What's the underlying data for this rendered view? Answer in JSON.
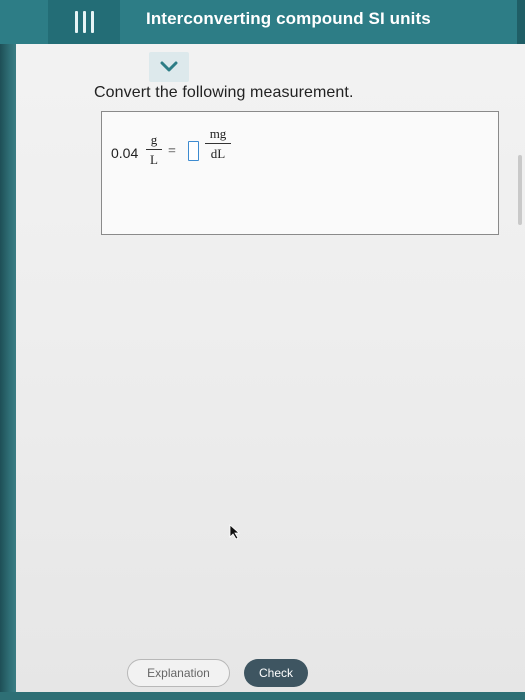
{
  "header": {
    "title": "Interconverting compound SI units",
    "menu_icon": "hamburger-icon",
    "accent_color": "#2d7d86"
  },
  "collapse": {
    "icon": "chevron-down-icon",
    "color": "#2d7d86"
  },
  "question": {
    "prompt": "Convert the following measurement."
  },
  "equation": {
    "value": "0.04",
    "given_unit": {
      "numerator": "g",
      "denominator": "L"
    },
    "equals": "=",
    "answer_value": "",
    "target_unit": {
      "numerator": "mg",
      "denominator": "dL"
    }
  },
  "footer": {
    "explanation_label": "Explanation",
    "check_label": "Check"
  }
}
